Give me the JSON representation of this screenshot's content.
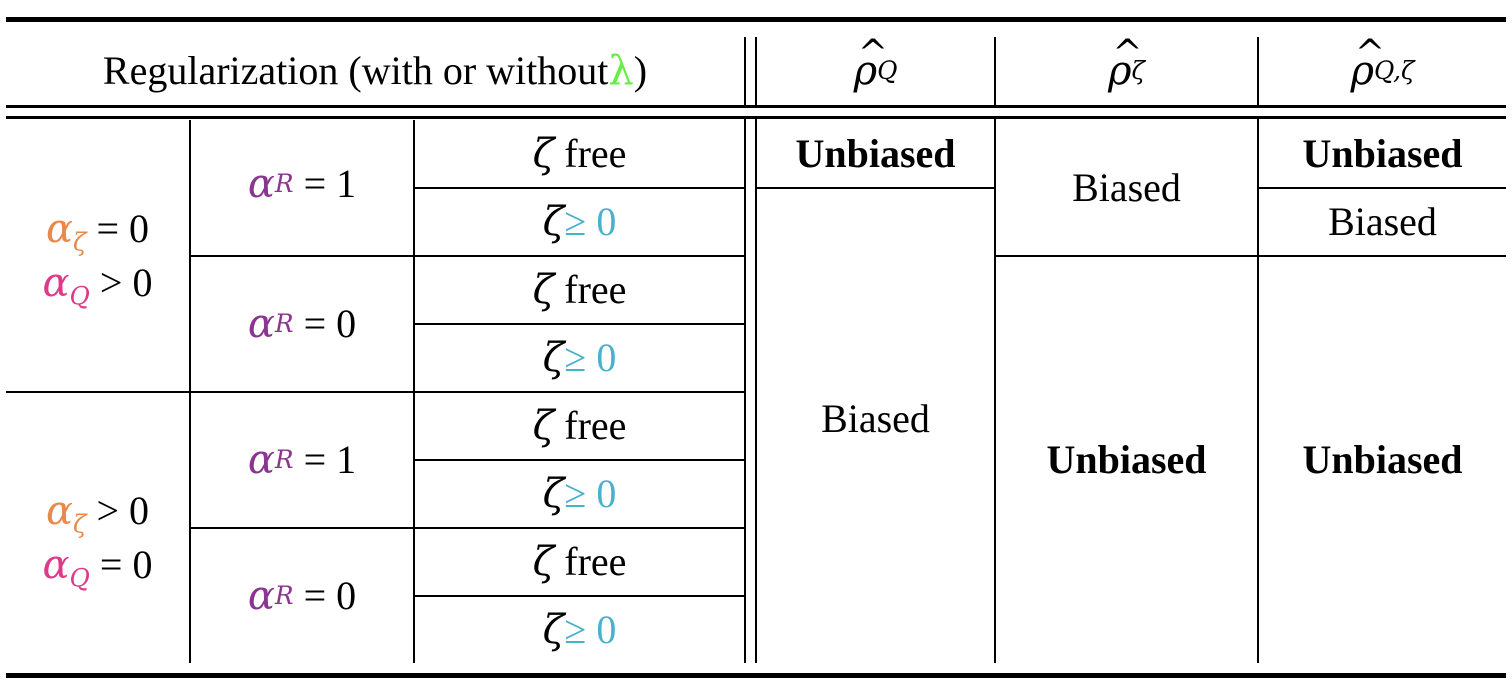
{
  "colors": {
    "lambda": "#66ee44",
    "alpha_zeta": "#e8894a",
    "alpha_Q": "#dd3a8a",
    "alpha_R": "#8a3590",
    "geq": "#4ab0cc"
  },
  "header": {
    "regularization_text": "Regularization (with or without ",
    "lambda_symbol": "λ",
    "regularization_close": ")",
    "col1_base": "ρ",
    "col1_sub": "Q",
    "col2_base": "ρ",
    "col2_sub": "ζ",
    "col3_base": "ρ",
    "col3_sub": "Q,ζ"
  },
  "groups": [
    {
      "alpha_zeta_label": "α",
      "alpha_zeta_sub": "ζ",
      "alpha_zeta_rel": "= 0",
      "alpha_Q_label": "α",
      "alpha_Q_sub": "Q",
      "alpha_Q_rel": "> 0",
      "subgroups": [
        {
          "alpha_R": "α",
          "alpha_R_sub": "R",
          "alpha_R_rel": " = 1",
          "rows": [
            {
              "zeta": "ζ",
              "constraint": " free"
            },
            {
              "zeta": "ζ",
              "constraint": "≥ 0"
            }
          ]
        },
        {
          "alpha_R": "α",
          "alpha_R_sub": "R",
          "alpha_R_rel": " = 0",
          "rows": [
            {
              "zeta": "ζ",
              "constraint": " free"
            },
            {
              "zeta": "ζ",
              "constraint": "≥ 0"
            }
          ]
        }
      ]
    },
    {
      "alpha_zeta_label": "α",
      "alpha_zeta_sub": "ζ",
      "alpha_zeta_rel": "> 0",
      "alpha_Q_label": "α",
      "alpha_Q_sub": "Q",
      "alpha_Q_rel": "= 0",
      "subgroups": [
        {
          "alpha_R": "α",
          "alpha_R_sub": "R",
          "alpha_R_rel": " = 1",
          "rows": [
            {
              "zeta": "ζ",
              "constraint": " free"
            },
            {
              "zeta": "ζ",
              "constraint": "≥ 0"
            }
          ]
        },
        {
          "alpha_R": "α",
          "alpha_R_sub": "R",
          "alpha_R_rel": " = 0",
          "rows": [
            {
              "zeta": "ζ",
              "constraint": " free"
            },
            {
              "zeta": "ζ",
              "constraint": "≥ 0"
            }
          ]
        }
      ]
    }
  ],
  "results": {
    "rhoQ_row1": "Unbiased",
    "rhoQ_rest": "Biased",
    "rhoZeta_top": "Biased",
    "rhoZeta_rest": "Unbiased",
    "rhoQZeta_row1": "Unbiased",
    "rhoQZeta_row2": "Biased",
    "rhoQZeta_rest": "Unbiased"
  }
}
